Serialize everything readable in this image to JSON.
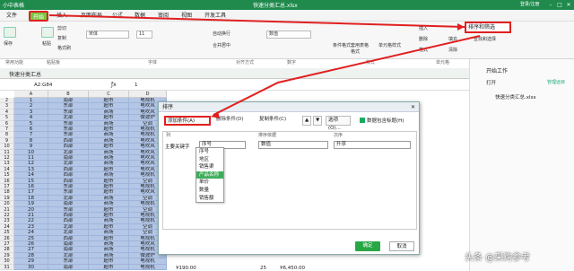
{
  "app_title": "小中表格",
  "file_title": "快速分类汇总.xlsx",
  "user_link": "登录/注册",
  "menu": {
    "file": "文件",
    "home": "开始",
    "insert": "插入",
    "page_layout": "页面布局",
    "formula": "公式",
    "data": "数据",
    "review": "审阅",
    "view": "视图",
    "developer": "开发工具"
  },
  "ribbon": {
    "save": "保存",
    "cut": "剪切",
    "copy": "复制",
    "format_painter": "格式刷",
    "paste": "粘贴",
    "font_name": "宋体",
    "font_size": "11",
    "wrap": "自动换行",
    "merge": "合并居中",
    "number_format": "数值",
    "cond_format": "条件格式",
    "table_style": "套用表格格式",
    "cell_style": "单元格样式",
    "insert": "插入",
    "delete": "删除",
    "format": "格式",
    "sort_filter": "排序和筛选",
    "find_select": "查找和选择",
    "fill": "填充",
    "clear": "清除",
    "group_common": "常用功能",
    "group_clipboard": "粘贴板",
    "group_font": "字体",
    "group_align": "对齐方式",
    "group_number": "数字",
    "group_style": "样式",
    "group_cells": "单元格",
    "group_edit": "编辑"
  },
  "sheet_tab": "快速分类汇总",
  "name_box": "A2:G84",
  "formula_value": "1",
  "columns": [
    "A",
    "B",
    "C",
    "D"
  ],
  "rows": [
    {
      "n": "2",
      "cells": [
        "1",
        "南部",
        "超市",
        "电视机"
      ]
    },
    {
      "n": "3",
      "cells": [
        "2",
        "东部",
        "超市",
        "电吹风"
      ]
    },
    {
      "n": "4",
      "cells": [
        "3",
        "东部",
        "商场",
        "电吹风"
      ]
    },
    {
      "n": "5",
      "cells": [
        "4",
        "北部",
        "超市",
        "微波炉"
      ]
    },
    {
      "n": "6",
      "cells": [
        "5",
        "东部",
        "商场",
        "空调"
      ]
    },
    {
      "n": "7",
      "cells": [
        "6",
        "东部",
        "超市",
        "电视机"
      ]
    },
    {
      "n": "8",
      "cells": [
        "7",
        "东部",
        "商场",
        "电视机"
      ]
    },
    {
      "n": "9",
      "cells": [
        "8",
        "西部",
        "商场",
        "电吹风"
      ]
    },
    {
      "n": "10",
      "cells": [
        "9",
        "西部",
        "超市",
        "电吹风"
      ]
    },
    {
      "n": "11",
      "cells": [
        "10",
        "北部",
        "商场",
        "电吹风"
      ]
    },
    {
      "n": "12",
      "cells": [
        "11",
        "南部",
        "商场",
        "电吹风"
      ]
    },
    {
      "n": "13",
      "cells": [
        "12",
        "北部",
        "商场",
        "电吹风"
      ]
    },
    {
      "n": "14",
      "cells": [
        "13",
        "西部",
        "超市",
        "电吹风"
      ]
    },
    {
      "n": "15",
      "cells": [
        "14",
        "西部",
        "商场",
        "电视机"
      ]
    },
    {
      "n": "16",
      "cells": [
        "15",
        "西部",
        "超市",
        "空调"
      ]
    },
    {
      "n": "17",
      "cells": [
        "16",
        "东部",
        "超市",
        "电视机"
      ]
    },
    {
      "n": "18",
      "cells": [
        "17",
        "东部",
        "超市",
        "电吹风"
      ]
    },
    {
      "n": "19",
      "cells": [
        "18",
        "北部",
        "商场",
        "空调"
      ]
    },
    {
      "n": "20",
      "cells": [
        "19",
        "南部",
        "商场",
        "电视机"
      ]
    },
    {
      "n": "21",
      "cells": [
        "20",
        "东部",
        "超市",
        "空调"
      ]
    },
    {
      "n": "22",
      "cells": [
        "21",
        "西部",
        "超市",
        "电视机"
      ]
    },
    {
      "n": "23",
      "cells": [
        "22",
        "西部",
        "商场",
        "电视机"
      ]
    },
    {
      "n": "24",
      "cells": [
        "23",
        "北部",
        "超市",
        "空调"
      ]
    },
    {
      "n": "25",
      "cells": [
        "24",
        "北部",
        "商场",
        "空调"
      ]
    },
    {
      "n": "26",
      "cells": [
        "25",
        "西部",
        "超市",
        "电视机"
      ]
    },
    {
      "n": "27",
      "cells": [
        "26",
        "南部",
        "商场",
        "电吹风"
      ]
    },
    {
      "n": "28",
      "cells": [
        "27",
        "南部",
        "商场",
        "电视机"
      ]
    },
    {
      "n": "29",
      "cells": [
        "28",
        "北部",
        "商场",
        "微波炉"
      ]
    },
    {
      "n": "30",
      "cells": [
        "29",
        "东部",
        "超市",
        "电视机"
      ]
    },
    {
      "n": "31",
      "cells": [
        "30",
        "南部",
        "超市",
        "电视机"
      ]
    }
  ],
  "right_panel": {
    "title": "开始工作",
    "open": "打开",
    "manage": "管理远目",
    "recent_file": "快速分类汇总.xlsx"
  },
  "dialog": {
    "title": "排序",
    "add_condition": "添加条件(A)",
    "delete_condition": "删除条件(D)",
    "copy_condition": "复制条件(C)",
    "options": "选项(O)...",
    "has_header": "数据包含标题(H)",
    "col_header": "列",
    "sort_basis_header": "排序依据",
    "order_header": "次序",
    "primary_key_label": "主要关键字",
    "primary_key_value": "序号",
    "sort_basis_value": "数值",
    "order_value": "升序",
    "ok": "确定",
    "cancel": "取消",
    "dropdown": [
      {
        "label": "序号",
        "selected": false
      },
      {
        "label": "地区",
        "selected": false
      },
      {
        "label": "销售渠",
        "selected": false
      },
      {
        "label": "产品名称",
        "selected": true
      },
      {
        "label": "单价",
        "selected": false
      },
      {
        "label": "数量",
        "selected": false
      },
      {
        "label": "销售额",
        "selected": false
      }
    ]
  },
  "bottom_partial": {
    "value1": "¥190.00",
    "value2": "25",
    "value3": "¥6,450.00"
  },
  "watermark": "头条 @采购参考"
}
